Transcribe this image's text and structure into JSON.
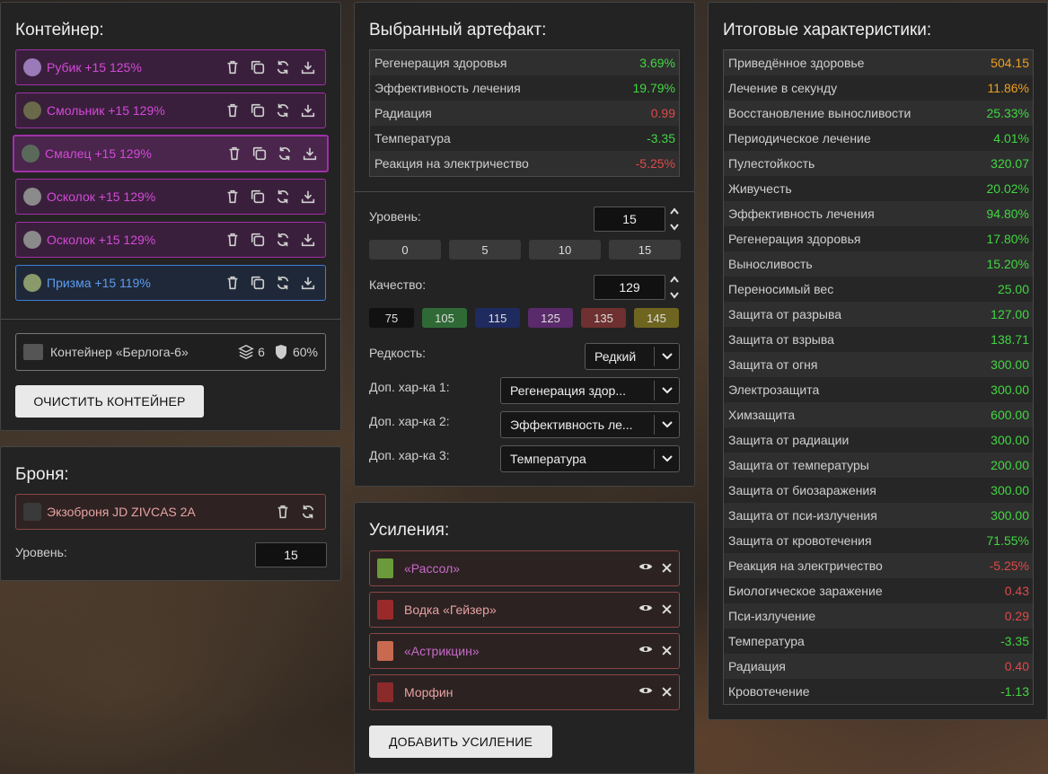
{
  "container": {
    "title": "Контейнер:",
    "items": [
      {
        "name": "Рубик +15 125%",
        "style": "purple"
      },
      {
        "name": "Смольник +15 129%",
        "style": "purple"
      },
      {
        "name": "Смалец +15 129%",
        "style": "purple"
      },
      {
        "name": "Осколок +15 129%",
        "style": "purple"
      },
      {
        "name": "Осколок +15 129%",
        "style": "purple"
      },
      {
        "name": "Призма +15 119%",
        "style": "blue"
      }
    ],
    "info": {
      "name": "Контейнер «Берлога-6»",
      "capacity": "6",
      "protection": "60%"
    },
    "clear_button": "ОЧИСТИТЬ КОНТЕЙНЕР"
  },
  "armor": {
    "title": "Броня:",
    "item": "Экзоброня JD ZIVCAS 2A",
    "level_label": "Уровень:",
    "level_value": "15"
  },
  "artifact": {
    "title": "Выбранный артефакт:",
    "stats": [
      {
        "label": "Регенерация здоровья",
        "value": "3.69%",
        "color": "green"
      },
      {
        "label": "Эффективность лечения",
        "value": "19.79%",
        "color": "green"
      },
      {
        "label": "Радиация",
        "value": "0.99",
        "color": "red"
      },
      {
        "label": "Температура",
        "value": "-3.35",
        "color": "green"
      },
      {
        "label": "Реакция на электричество",
        "value": "-5.25%",
        "color": "red"
      }
    ],
    "level_label": "Уровень:",
    "level_value": "15",
    "level_presets": [
      "0",
      "5",
      "10",
      "15"
    ],
    "quality_label": "Качество:",
    "quality_value": "129",
    "quality_presets": [
      {
        "label": "75",
        "color": "#111111"
      },
      {
        "label": "105",
        "color": "#2f6a36"
      },
      {
        "label": "115",
        "color": "#1f2a5e"
      },
      {
        "label": "125",
        "color": "#5a2a6a"
      },
      {
        "label": "135",
        "color": "#6e3030"
      },
      {
        "label": "145",
        "color": "#6e6520"
      }
    ],
    "rarity_label": "Редкость:",
    "rarity_value": "Редкий",
    "extra1_label": "Доп. хар-ка 1:",
    "extra1_value": "Регенерация здор...",
    "extra2_label": "Доп. хар-ка 2:",
    "extra2_value": "Эффективность ле...",
    "extra3_label": "Доп. хар-ка 3:",
    "extra3_value": "Температура"
  },
  "boosts": {
    "title": "Усиления:",
    "items": [
      {
        "name": "«Рассол»",
        "color": "#c86ac8",
        "icon": "#6a9a3a"
      },
      {
        "name": "Водка «Гейзер»",
        "color": "#e8a2a2",
        "icon": "#9a2a2a"
      },
      {
        "name": "«Астрикцин»",
        "color": "#c86ac8",
        "icon": "#c86a50"
      },
      {
        "name": "Морфин",
        "color": "#e8a2a2",
        "icon": "#8a2a2a"
      }
    ],
    "add_button": "ДОБАВИТЬ УСИЛЕНИЕ"
  },
  "totals": {
    "title": "Итоговые характеристики:",
    "stats": [
      {
        "label": "Приведённое здоровье",
        "value": "504.15",
        "color": "orange"
      },
      {
        "label": "Лечение в секунду",
        "value": "11.86%",
        "color": "orange"
      },
      {
        "label": "Восстановление выносливости",
        "value": "25.33%",
        "color": "green"
      },
      {
        "label": "Периодическое лечение",
        "value": "4.01%",
        "color": "green"
      },
      {
        "label": "Пулестойкость",
        "value": "320.07",
        "color": "green"
      },
      {
        "label": "Живучесть",
        "value": "20.02%",
        "color": "green"
      },
      {
        "label": "Эффективность лечения",
        "value": "94.80%",
        "color": "green"
      },
      {
        "label": "Регенерация здоровья",
        "value": "17.80%",
        "color": "green"
      },
      {
        "label": "Выносливость",
        "value": "15.20%",
        "color": "green"
      },
      {
        "label": "Переносимый вес",
        "value": "25.00",
        "color": "green"
      },
      {
        "label": "Защита от разрыва",
        "value": "127.00",
        "color": "green"
      },
      {
        "label": "Защита от взрыва",
        "value": "138.71",
        "color": "green"
      },
      {
        "label": "Защита от огня",
        "value": "300.00",
        "color": "green"
      },
      {
        "label": "Электрозащита",
        "value": "300.00",
        "color": "green"
      },
      {
        "label": "Химзащита",
        "value": "600.00",
        "color": "green"
      },
      {
        "label": "Защита от радиации",
        "value": "300.00",
        "color": "green"
      },
      {
        "label": "Защита от температуры",
        "value": "200.00",
        "color": "green"
      },
      {
        "label": "Защита от биозаражения",
        "value": "300.00",
        "color": "green"
      },
      {
        "label": "Защита от пси-излучения",
        "value": "300.00",
        "color": "green"
      },
      {
        "label": "Защита от кровотечения",
        "value": "71.55%",
        "color": "green"
      },
      {
        "label": "Реакция на электричество",
        "value": "-5.25%",
        "color": "red"
      },
      {
        "label": "Биологическое заражение",
        "value": "0.43",
        "color": "red"
      },
      {
        "label": "Пси-излучение",
        "value": "0.29",
        "color": "red"
      },
      {
        "label": "Температура",
        "value": "-3.35",
        "color": "green"
      },
      {
        "label": "Радиация",
        "value": "0.40",
        "color": "red"
      },
      {
        "label": "Кровотечение",
        "value": "-1.13",
        "color": "green"
      }
    ]
  }
}
